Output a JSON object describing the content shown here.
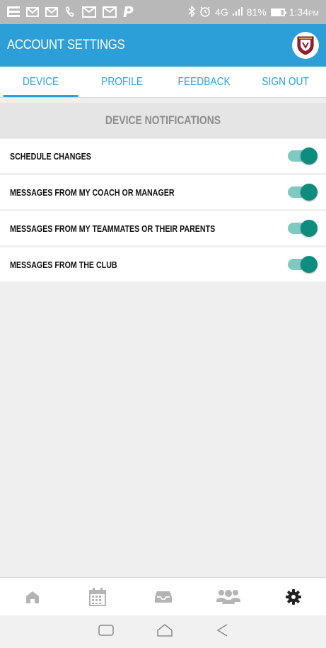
{
  "status_bar": {
    "network": "4G",
    "battery": "81%",
    "battery_level": 0.81,
    "time": "1:34",
    "ampm": "PM"
  },
  "header": {
    "title": "ACCOUNT SETTINGS",
    "logo_icon": "club-crest-icon"
  },
  "tabs": [
    {
      "label": "DEVICE",
      "active": true
    },
    {
      "label": "PROFILE",
      "active": false
    },
    {
      "label": "FEEDBACK",
      "active": false
    },
    {
      "label": "SIGN OUT",
      "active": false
    }
  ],
  "section": {
    "title": "DEVICE NOTIFICATIONS"
  },
  "notifications": [
    {
      "label": "SCHEDULE CHANGES",
      "enabled": true
    },
    {
      "label": "MESSAGES FROM MY COACH OR MANAGER",
      "enabled": true
    },
    {
      "label": "MESSAGES FROM MY TEAMMATES OR THEIR PARENTS",
      "enabled": true
    },
    {
      "label": "MESSAGES FROM THE CLUB",
      "enabled": true
    }
  ],
  "bottom_nav": [
    {
      "icon": "home-icon",
      "active": false
    },
    {
      "icon": "calendar-icon",
      "active": false
    },
    {
      "icon": "inbox-icon",
      "active": false
    },
    {
      "icon": "team-icon",
      "active": false
    },
    {
      "icon": "gear-icon",
      "active": true
    }
  ],
  "colors": {
    "primary": "#2d9fd8",
    "toggle_knob": "#0e8c7e",
    "toggle_track": "#7fc9c0",
    "nav_inactive": "#b4b4b4",
    "nav_active": "#222222"
  }
}
